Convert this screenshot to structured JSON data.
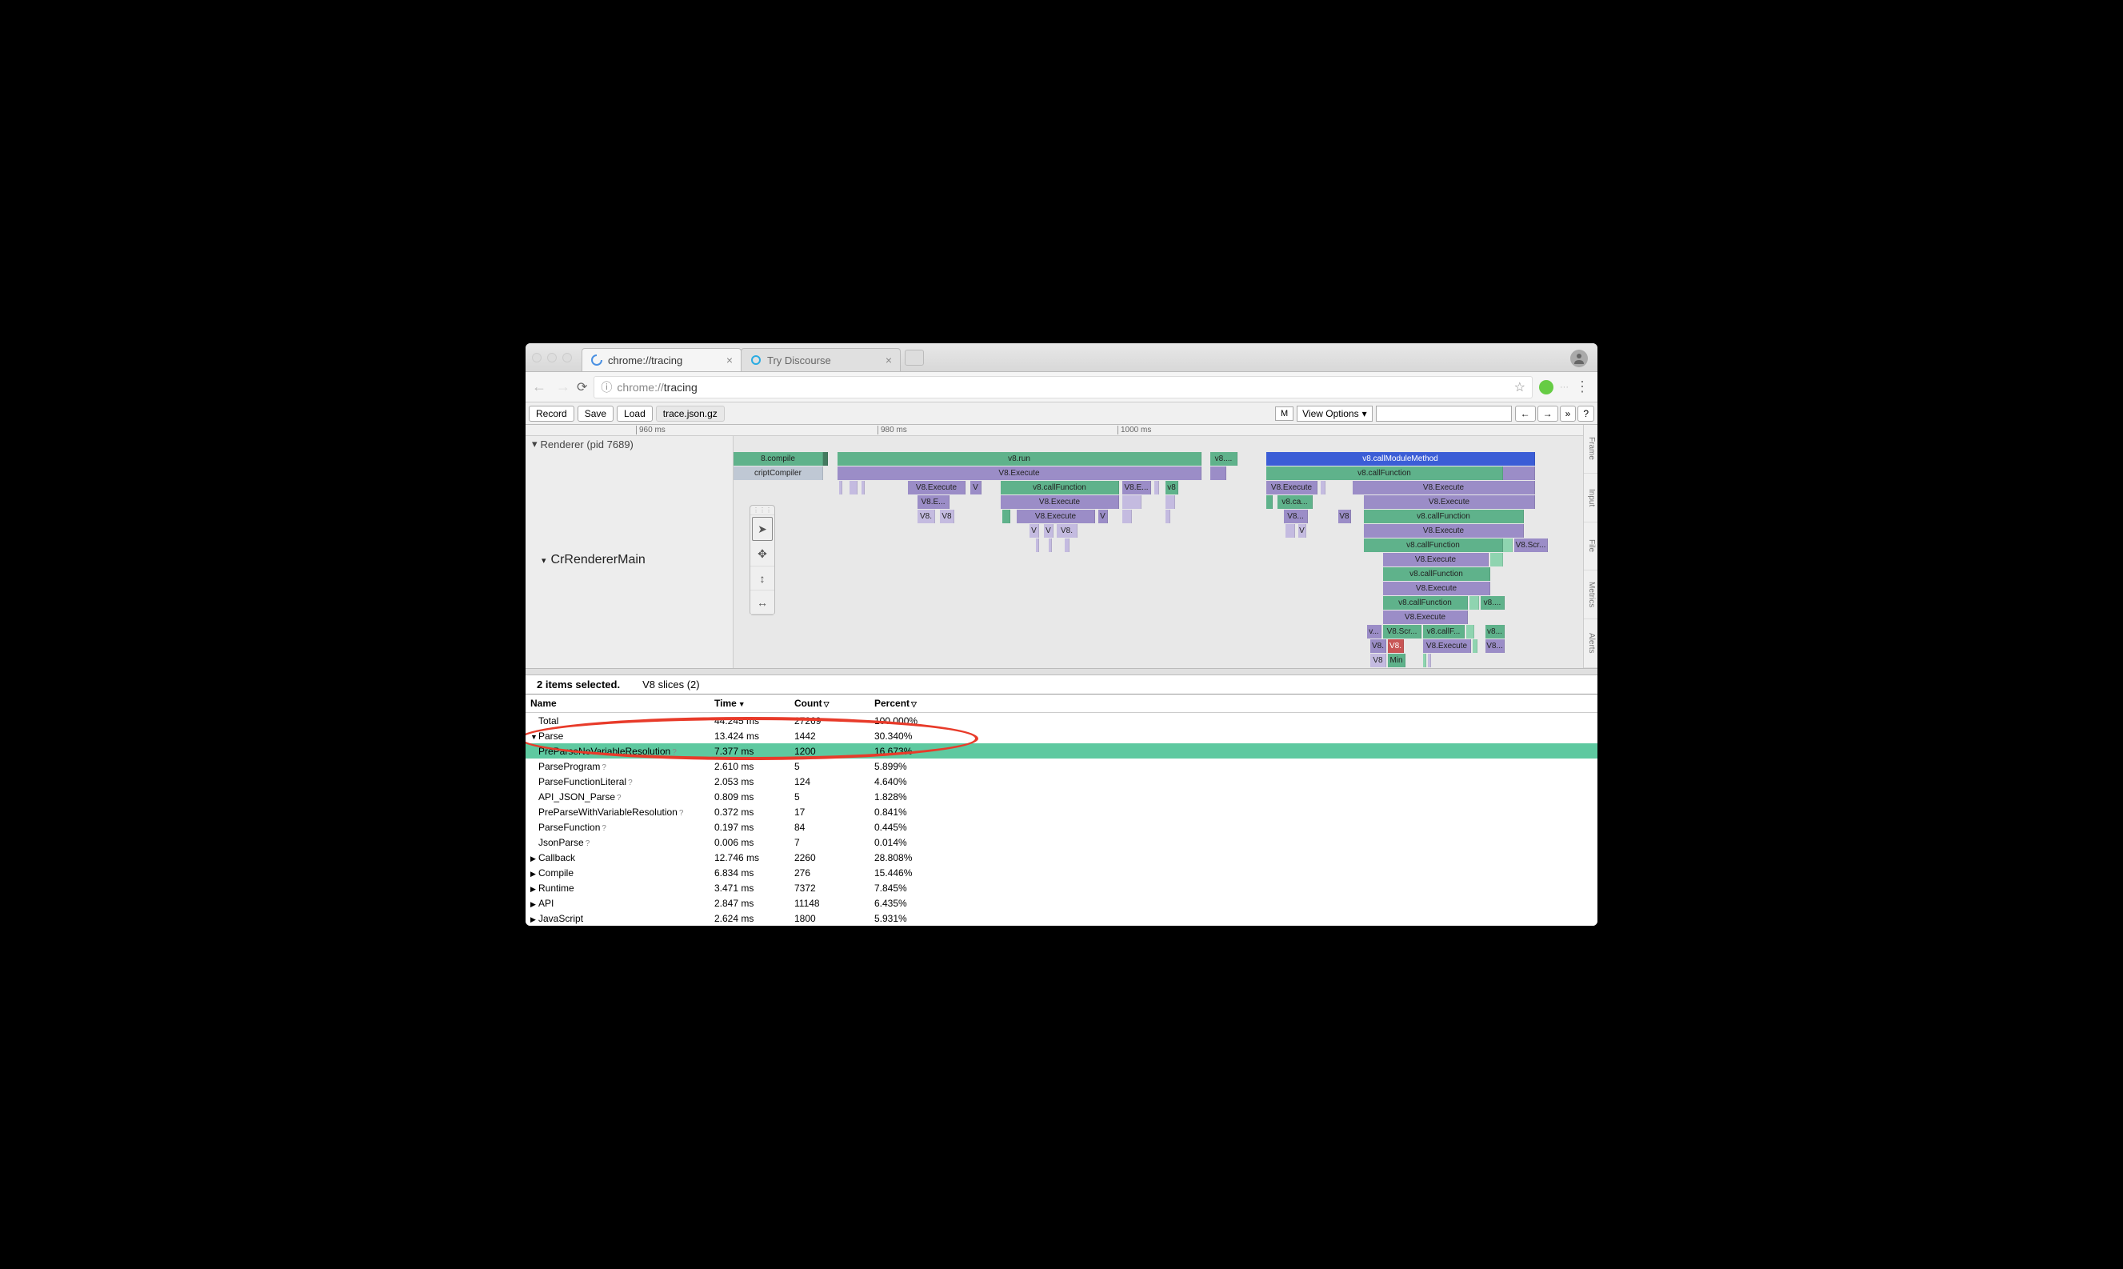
{
  "browser": {
    "tabs": [
      {
        "title": "chrome://tracing",
        "active": true
      },
      {
        "title": "Try Discourse",
        "active": false
      }
    ],
    "url_display_prefix": "chrome://",
    "url_display_path": "tracing"
  },
  "toolbar": {
    "record": "Record",
    "save": "Save",
    "load": "Load",
    "filename": "trace.json.gz",
    "m_button": "M",
    "view_options": "View Options",
    "nav_prev": "←",
    "nav_next": "→",
    "nav_expand": "»",
    "help": "?"
  },
  "ruler": {
    "ticks": [
      "960 ms",
      "980 ms",
      "1000 ms"
    ]
  },
  "processes": {
    "renderer_label": "Renderer (pid 7689)",
    "thread_label": "CrRendererMain"
  },
  "side_tabs": [
    "Frame",
    "Input",
    "File",
    "Metrics",
    "Alerts"
  ],
  "slices": {
    "row0": [
      "8.compile",
      "v8.run",
      "v8....",
      "v8.callModuleMethod"
    ],
    "row1": [
      "criptCompiler",
      "V8.Execute",
      "v8.callFunction"
    ],
    "row2": [
      "V8.Execute",
      "V",
      "v8.callFunction",
      "V8.E...",
      "v8",
      "V8.Execute",
      "V8.Execute"
    ],
    "row3": [
      "V8.E...",
      "V8.Execute",
      "v8.ca...",
      "V8.Execute"
    ],
    "row4": [
      "V8.",
      "V8",
      "V8.Execute",
      "V",
      "V8...",
      "V8",
      "v8.callFunction"
    ],
    "row5": [
      "V",
      "V",
      "V8.",
      "V",
      "V8.Execute"
    ],
    "row6": [
      "v8.callFunction",
      "V8.Scr..."
    ],
    "row7": [
      "V8.Execute"
    ],
    "row8": [
      "v8.callFunction"
    ],
    "row9": [
      "V8.Execute"
    ],
    "row10": [
      "v8.callFunction",
      "v8...."
    ],
    "row11": [
      "V8.Execute"
    ],
    "row12": [
      "v...",
      "V8.Scr...",
      "v8.callF...",
      "v8..."
    ],
    "row13": [
      "V8.",
      "V8.",
      "V8.Execute",
      "V8..."
    ],
    "row14": [
      "V8",
      "Min"
    ]
  },
  "selection": {
    "status": "2 items selected.",
    "slices_label": "V8 slices (2)",
    "columns": {
      "name": "Name",
      "time": "Time",
      "count": "Count",
      "percent": "Percent"
    },
    "rows": [
      {
        "indent": 0,
        "expander": "",
        "name": "Total",
        "time": "44.245 ms",
        "count": "27269",
        "percent": "100.000%",
        "q": false
      },
      {
        "indent": 0,
        "expander": "▼",
        "name": "Parse",
        "time": "13.424 ms",
        "count": "1442",
        "percent": "30.340%",
        "q": false
      },
      {
        "indent": 1,
        "expander": "",
        "name": "PreParseNoVariableResolution",
        "time": "7.377 ms",
        "count": "1200",
        "percent": "16.673%",
        "q": true,
        "highlight": true
      },
      {
        "indent": 1,
        "expander": "",
        "name": "ParseProgram",
        "time": "2.610 ms",
        "count": "5",
        "percent": "5.899%",
        "q": true
      },
      {
        "indent": 1,
        "expander": "",
        "name": "ParseFunctionLiteral",
        "time": "2.053 ms",
        "count": "124",
        "percent": "4.640%",
        "q": true
      },
      {
        "indent": 1,
        "expander": "",
        "name": "API_JSON_Parse",
        "time": "0.809 ms",
        "count": "5",
        "percent": "1.828%",
        "q": true
      },
      {
        "indent": 1,
        "expander": "",
        "name": "PreParseWithVariableResolution",
        "time": "0.372 ms",
        "count": "17",
        "percent": "0.841%",
        "q": true
      },
      {
        "indent": 1,
        "expander": "",
        "name": "ParseFunction",
        "time": "0.197 ms",
        "count": "84",
        "percent": "0.445%",
        "q": true
      },
      {
        "indent": 1,
        "expander": "",
        "name": "JsonParse",
        "time": "0.006 ms",
        "count": "7",
        "percent": "0.014%",
        "q": true
      },
      {
        "indent": 0,
        "expander": "▶",
        "name": "Callback",
        "time": "12.746 ms",
        "count": "2260",
        "percent": "28.808%",
        "q": false
      },
      {
        "indent": 0,
        "expander": "▶",
        "name": "Compile",
        "time": "6.834 ms",
        "count": "276",
        "percent": "15.446%",
        "q": false
      },
      {
        "indent": 0,
        "expander": "▶",
        "name": "Runtime",
        "time": "3.471 ms",
        "count": "7372",
        "percent": "7.845%",
        "q": false
      },
      {
        "indent": 0,
        "expander": "▶",
        "name": "API",
        "time": "2.847 ms",
        "count": "11148",
        "percent": "6.435%",
        "q": false
      },
      {
        "indent": 0,
        "expander": "▶",
        "name": "JavaScript",
        "time": "2.624 ms",
        "count": "1800",
        "percent": "5.931%",
        "q": false
      }
    ]
  }
}
